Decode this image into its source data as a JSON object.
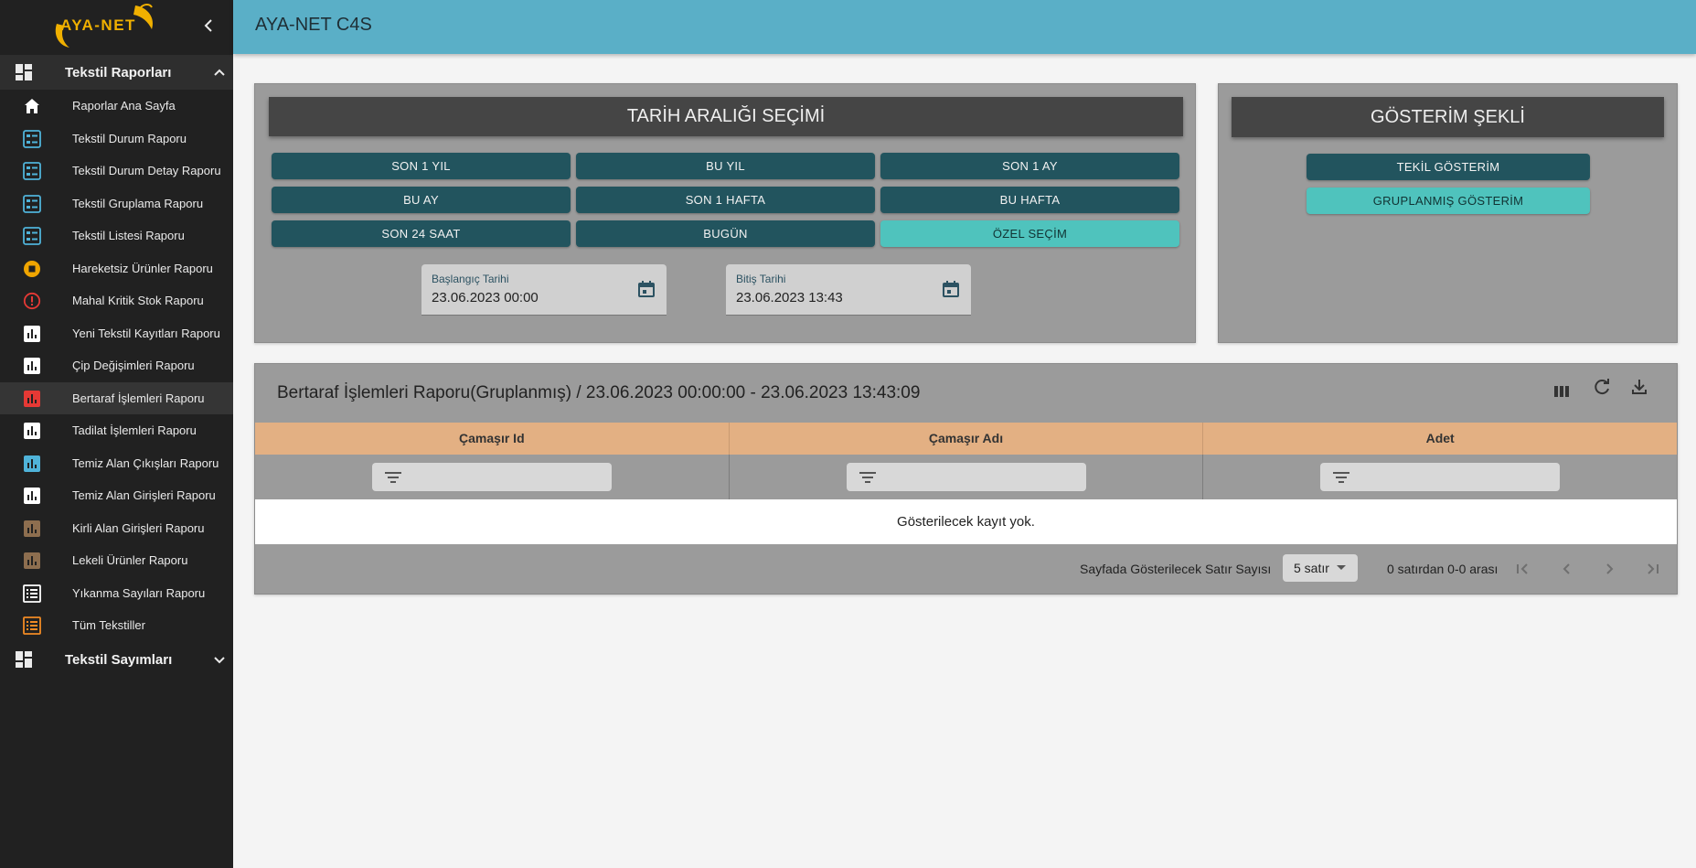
{
  "app": {
    "logo_text": "AYA-NET",
    "header_title": "AYA-NET C4S"
  },
  "sidebar": {
    "groups": [
      {
        "label": "Tekstil Raporları",
        "expanded": true,
        "items": [
          {
            "label": "Raporlar Ana Sayfa",
            "icon": "home-icon",
            "color": "#ffffff"
          },
          {
            "label": "Tekstil Durum Raporu",
            "icon": "list-check-icon",
            "color": "#4fb3d9"
          },
          {
            "label": "Tekstil Durum Detay Raporu",
            "icon": "list-check-icon",
            "color": "#4fb3d9"
          },
          {
            "label": "Tekstil Gruplama Raporu",
            "icon": "list-check-icon",
            "color": "#4fb3d9"
          },
          {
            "label": "Tekstil Listesi Raporu",
            "icon": "list-check-icon",
            "color": "#4fb3d9"
          },
          {
            "label": "Hareketsiz Ürünler Raporu",
            "icon": "stop-circle-icon",
            "color": "#f0a500"
          },
          {
            "label": "Mahal Kritik Stok Raporu",
            "icon": "alert-circle-icon",
            "color": "#e53935"
          },
          {
            "label": "Yeni Tekstil Kayıtları Raporu",
            "icon": "bar-chart-icon",
            "color": "#ffffff"
          },
          {
            "label": "Çip Değişimleri Raporu",
            "icon": "bar-chart-icon",
            "color": "#ffffff"
          },
          {
            "label": "Bertaraf İşlemleri Raporu",
            "icon": "bar-chart-icon",
            "color": "#e53935"
          },
          {
            "label": "Tadilat İşlemleri Raporu",
            "icon": "bar-chart-icon",
            "color": "#ffffff"
          },
          {
            "label": "Temiz Alan Çıkışları Raporu",
            "icon": "bar-chart-icon",
            "color": "#4fb3d9"
          },
          {
            "label": "Temiz Alan Girişleri Raporu",
            "icon": "bar-chart-icon",
            "color": "#ffffff"
          },
          {
            "label": "Kirli Alan Girişleri Raporu",
            "icon": "bar-chart-icon",
            "color": "#8d6e4f"
          },
          {
            "label": "Lekeli Ürünler Raporu",
            "icon": "bar-chart-icon",
            "color": "#8d6e4f"
          },
          {
            "label": "Yıkanma Sayıları Raporu",
            "icon": "list-icon",
            "color": "#ffffff"
          },
          {
            "label": "Tüm Tekstiller",
            "icon": "list-icon",
            "color": "#f08a24"
          }
        ]
      },
      {
        "label": "Tekstil Sayımları",
        "expanded": false
      }
    ],
    "active_item": "Bertaraf İşlemleri Raporu"
  },
  "date_panel": {
    "title": "TARİH ARALIĞI SEÇİMİ",
    "buttons": [
      "SON 1 YIL",
      "BU YIL",
      "SON 1 AY",
      "BU AY",
      "SON 1 HAFTA",
      "BU HAFTA",
      "SON 24 SAAT",
      "BUGÜN",
      "ÖZEL SEÇİM"
    ],
    "selected": "ÖZEL SEÇİM",
    "start": {
      "label": "Başlangıç Tarihi",
      "value": "23.06.2023 00:00"
    },
    "end": {
      "label": "Bitiş Tarihi",
      "value": "23.06.2023 13:43"
    }
  },
  "display_panel": {
    "title": "GÖSTERİM ŞEKLİ",
    "buttons": [
      "TEKİL GÖSTERİM",
      "GRUPLANMIŞ GÖSTERİM"
    ],
    "selected": "GRUPLANMIŞ GÖSTERİM"
  },
  "table": {
    "title": "Bertaraf İşlemleri Raporu(Gruplanmış) / 23.06.2023 00:00:00 - 23.06.2023 13:43:09",
    "columns": [
      "Çamaşır Id",
      "Çamaşır Adı",
      "Adet"
    ],
    "empty_text": "Gösterilecek kayıt yok.",
    "rows_per_page_label": "Sayfada Gösterilecek Satır Sayısı",
    "rows_per_page_value": "5 satır",
    "range_text": "0 satırdan 0-0 arası"
  },
  "colors": {
    "header": "#5aafc7",
    "sidebar": "#212121",
    "button": "#22545e",
    "button_selected": "#4fc3bd",
    "table_header": "#e3b083"
  }
}
